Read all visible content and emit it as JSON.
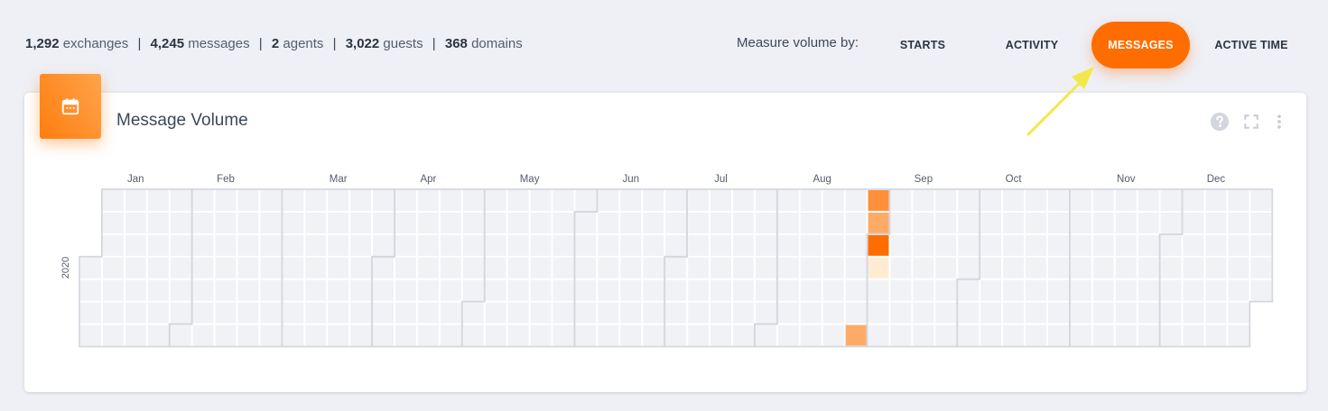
{
  "stats": [
    {
      "value": "1,292",
      "label": "exchanges"
    },
    {
      "value": "4,245",
      "label": "messages"
    },
    {
      "value": "2",
      "label": "agents"
    },
    {
      "value": "3,022",
      "label": "guests"
    },
    {
      "value": "368",
      "label": "domains"
    }
  ],
  "stats_separator": "|",
  "measure": {
    "label": "Measure volume by:",
    "options": [
      "STARTS",
      "ACTIVITY",
      "MESSAGES",
      "ACTIVE TIME"
    ],
    "selected": "MESSAGES"
  },
  "card": {
    "title": "Message Volume",
    "icon": "calendar-icon",
    "tools": [
      "help-icon",
      "fullscreen-icon",
      "more-vert-icon"
    ]
  },
  "colors": {
    "accent": "#ff6d00",
    "empty_cell": "#f1f2f6",
    "arrow": "#f2e84c"
  },
  "chart_data": {
    "type": "heatmap",
    "year": "2020",
    "months": [
      "Jan",
      "Feb",
      "Mar",
      "Apr",
      "May",
      "Jun",
      "Jul",
      "Aug",
      "Sep",
      "Oct",
      "Nov",
      "Dec"
    ],
    "highlighted_days": [
      {
        "date": "2020-08-29",
        "level": 0.55
      },
      {
        "date": "2020-08-30",
        "level": 0.75
      },
      {
        "date": "2020-08-31",
        "level": 0.55
      },
      {
        "date": "2020-09-01",
        "level": 1.0
      },
      {
        "date": "2020-09-02",
        "level": 0.08
      }
    ]
  }
}
